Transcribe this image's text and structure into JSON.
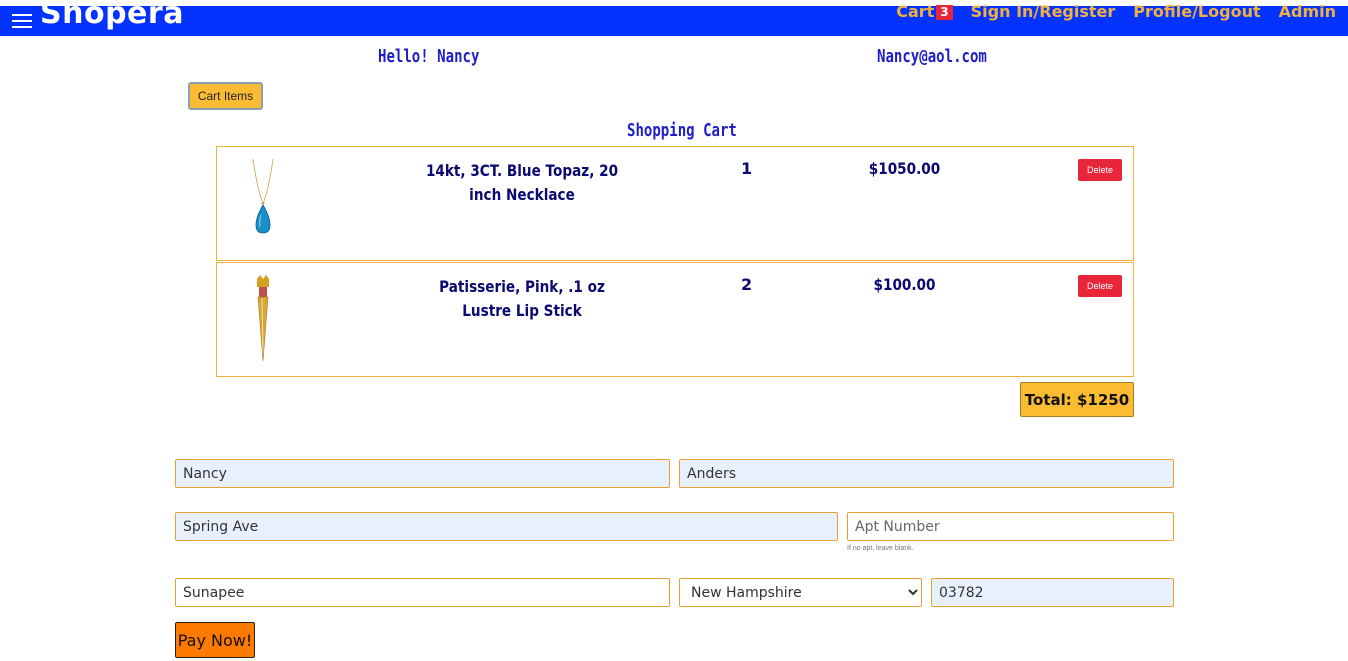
{
  "nav": {
    "brand": "Shopera",
    "cart_label": "Cart",
    "cart_count": "3",
    "signin_label": "Sign In/Register",
    "profile_label": "Profile/Logout",
    "admin_label": "Admin"
  },
  "user": {
    "greeting": "Hello! Nancy",
    "email": "Nancy@aol.com"
  },
  "cart_items_button": "Cart Items",
  "cart_title": "Shopping Cart",
  "items": [
    {
      "name": "14kt, 3CT. Blue Topaz, 20 inch Necklace",
      "qty": "1",
      "price": "$1050.00",
      "delete_label": "Delete"
    },
    {
      "name": "Patisserie, Pink, .1 oz Lustre Lip Stick",
      "qty": "2",
      "price": "$100.00",
      "delete_label": "Delete"
    }
  ],
  "total": "Total: $1250",
  "form": {
    "first_name": "Nancy",
    "last_name": "Anders",
    "street": "Spring Ave",
    "apt_placeholder": "Apt Number",
    "apt_help": "If no apt, leave blank.",
    "city": "Sunapee",
    "state": "New Hampshire",
    "zip": "03782",
    "pay_label": "Pay Now!"
  }
}
